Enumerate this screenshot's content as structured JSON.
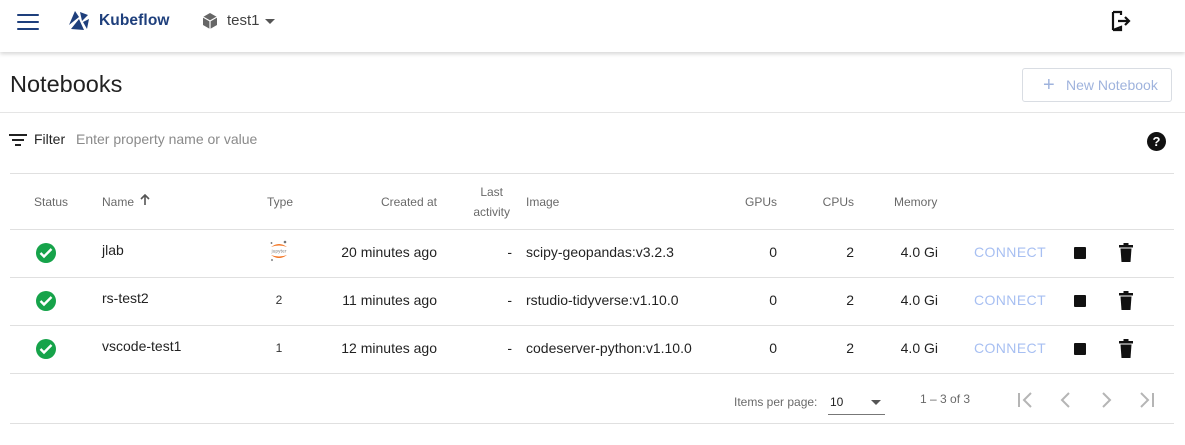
{
  "header": {
    "brand": "Kubeflow",
    "namespace": "test1"
  },
  "page": {
    "title": "Notebooks",
    "new_button_label": "New Notebook"
  },
  "filter": {
    "label": "Filter",
    "placeholder": "Enter property name or value"
  },
  "table": {
    "columns": {
      "status": "Status",
      "name": "Name",
      "type": "Type",
      "created": "Created at",
      "last_activity_1": "Last",
      "last_activity_2": "activity",
      "image": "Image",
      "gpus": "GPUs",
      "cpus": "CPUs",
      "memory": "Memory"
    },
    "rows": [
      {
        "name": "jlab",
        "type_icon": "jupyter-logo-icon",
        "type_label": "jupyter",
        "created": "20 minutes ago",
        "last_activity": "-",
        "image": "scipy-geopandas:v3.2.3",
        "gpus": "0",
        "cpus": "2",
        "memory": "4.0 Gi",
        "connect": "CONNECT"
      },
      {
        "name": "rs-test2",
        "type_label": "2",
        "created": "11 minutes ago",
        "last_activity": "-",
        "image": "rstudio-tidyverse:v1.10.0",
        "gpus": "0",
        "cpus": "2",
        "memory": "4.0 Gi",
        "connect": "CONNECT"
      },
      {
        "name": "vscode-test1",
        "type_label": "1",
        "created": "12 minutes ago",
        "last_activity": "-",
        "image": "codeserver-python:v1.10.0",
        "gpus": "0",
        "cpus": "2",
        "memory": "4.0 Gi",
        "connect": "CONNECT"
      }
    ]
  },
  "paginator": {
    "items_per_page_label": "Items per page:",
    "items_per_page_value": "10",
    "range": "1 – 3 of 3"
  },
  "colors": {
    "brand": "#1e3f7c",
    "status_ok": "#16a34a",
    "connect_disabled": "#a7bff2"
  }
}
